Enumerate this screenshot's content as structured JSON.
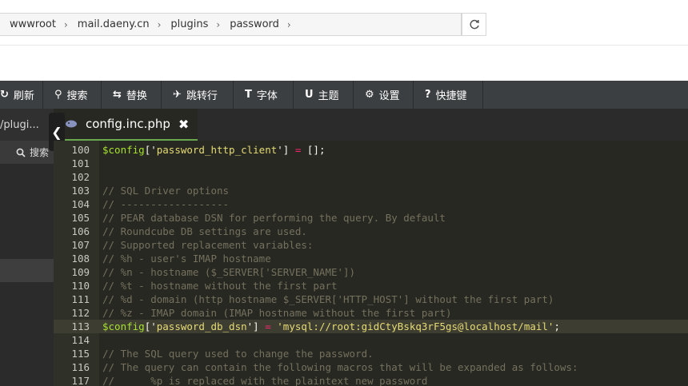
{
  "breadcrumb": [
    {
      "label": "wwwroot"
    },
    {
      "label": "mail.daeny.cn"
    },
    {
      "label": "plugins"
    },
    {
      "label": "password"
    }
  ],
  "toolbar": [
    {
      "icon": "refresh-icon",
      "glyph": "↻",
      "label": "刷新",
      "w": 54
    },
    {
      "icon": "search-icon",
      "glyph": "⚲",
      "label": "搜索",
      "w": 73
    },
    {
      "icon": "replace-icon",
      "glyph": "⇆",
      "label": "替换",
      "w": 75
    },
    {
      "icon": "goto-line-icon",
      "glyph": "✈",
      "label": "跳转行",
      "w": 90
    },
    {
      "icon": "font-icon",
      "glyph": "T",
      "label": "字体",
      "w": 75
    },
    {
      "icon": "theme-icon",
      "glyph": "U",
      "label": "主题",
      "w": 75
    },
    {
      "icon": "gear-icon",
      "glyph": "⚙",
      "label": "设置",
      "w": 75
    },
    {
      "icon": "help-icon",
      "glyph": "?",
      "label": "快捷键",
      "w": 87
    }
  ],
  "tabs": {
    "left_partial": "/plugi...",
    "active": {
      "filename": "config.inc.php",
      "close": "✖"
    }
  },
  "left_panel": {
    "search_label": "搜索"
  },
  "editor": {
    "lines": [
      {
        "n": "100",
        "tokens": [
          [
            "var",
            "$config"
          ],
          [
            "pun",
            "['"
          ],
          [
            "str",
            "password_http_client"
          ],
          [
            "pun",
            "'] "
          ],
          [
            "op",
            "="
          ],
          [
            "pun",
            " [];"
          ]
        ]
      },
      {
        "n": "101",
        "tokens": []
      },
      {
        "n": "102",
        "tokens": []
      },
      {
        "n": "103",
        "tokens": [
          [
            "com",
            "// SQL Driver options"
          ]
        ]
      },
      {
        "n": "104",
        "tokens": [
          [
            "com",
            "// ------------------"
          ]
        ]
      },
      {
        "n": "105",
        "tokens": [
          [
            "com",
            "// PEAR database DSN for performing the query. By default"
          ]
        ]
      },
      {
        "n": "106",
        "tokens": [
          [
            "com",
            "// Roundcube DB settings are used."
          ]
        ]
      },
      {
        "n": "107",
        "tokens": [
          [
            "com",
            "// Supported replacement variables:"
          ]
        ]
      },
      {
        "n": "108",
        "tokens": [
          [
            "com",
            "// %h - user's IMAP hostname"
          ]
        ]
      },
      {
        "n": "109",
        "tokens": [
          [
            "com",
            "// %n - hostname ($_SERVER['SERVER_NAME'])"
          ]
        ]
      },
      {
        "n": "110",
        "tokens": [
          [
            "com",
            "// %t - hostname without the first part"
          ]
        ]
      },
      {
        "n": "111",
        "tokens": [
          [
            "com",
            "// %d - domain (http hostname $_SERVER['HTTP_HOST'] without the first part)"
          ]
        ]
      },
      {
        "n": "112",
        "tokens": [
          [
            "com",
            "// %z - IMAP domain (IMAP hostname without the first part)"
          ]
        ]
      },
      {
        "n": "113",
        "active": true,
        "tokens": [
          [
            "var",
            "$config"
          ],
          [
            "pun",
            "['"
          ],
          [
            "str",
            "password_db_dsn"
          ],
          [
            "pun",
            "'] "
          ],
          [
            "op",
            "="
          ],
          [
            "pun",
            " "
          ],
          [
            "str",
            "'mysql://root:gidCtyBskq3rF5gs@localhost/mail'"
          ],
          [
            "pun",
            ";"
          ]
        ]
      },
      {
        "n": "114",
        "tokens": []
      },
      {
        "n": "115",
        "tokens": [
          [
            "com",
            "// The SQL query used to change the password."
          ]
        ]
      },
      {
        "n": "116",
        "tokens": [
          [
            "com",
            "// The query can contain the following macros that will be expanded as follows:"
          ]
        ]
      },
      {
        "n": "117",
        "tokens": [
          [
            "com",
            "//      %p is replaced with the plaintext new password"
          ]
        ]
      }
    ]
  }
}
